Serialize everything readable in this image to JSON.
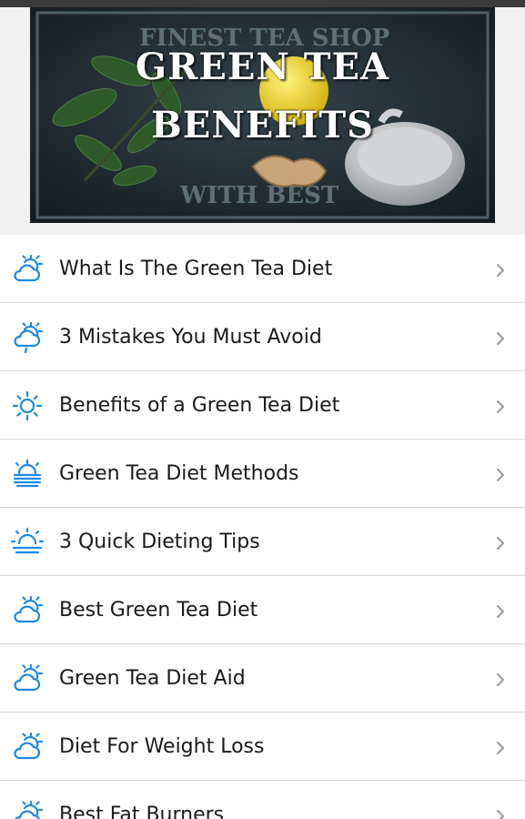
{
  "banner": {
    "title_line1": "GREEN TEA",
    "title_line2": "BENEFITS",
    "sign_text_top": "FINEST TEA SHOP",
    "sign_text_bottom": "WITH BEST"
  },
  "colors": {
    "icon": "#1e88e5",
    "chevron": "#9e9e9e",
    "divider": "#d6d6d6",
    "text": "#1a1a1a"
  },
  "menu": {
    "items": [
      {
        "label": "What Is The Green Tea Diet",
        "icon": "cloud-sun-icon"
      },
      {
        "label": "3 Mistakes You Must Avoid",
        "icon": "cloud-sun-rain-icon"
      },
      {
        "label": "Benefits of a Green Tea Diet",
        "icon": "sun-icon"
      },
      {
        "label": "Green Tea Diet Methods",
        "icon": "sun-fog-icon"
      },
      {
        "label": "3 Quick Dieting Tips",
        "icon": "sunset-icon"
      },
      {
        "label": "Best Green Tea Diet",
        "icon": "cloud-sun-icon"
      },
      {
        "label": "Green Tea Diet Aid",
        "icon": "cloud-sun-icon"
      },
      {
        "label": "Diet For Weight Loss",
        "icon": "cloud-sun-icon"
      },
      {
        "label": "Best Fat Burners",
        "icon": "cloud-sun-icon"
      }
    ]
  }
}
